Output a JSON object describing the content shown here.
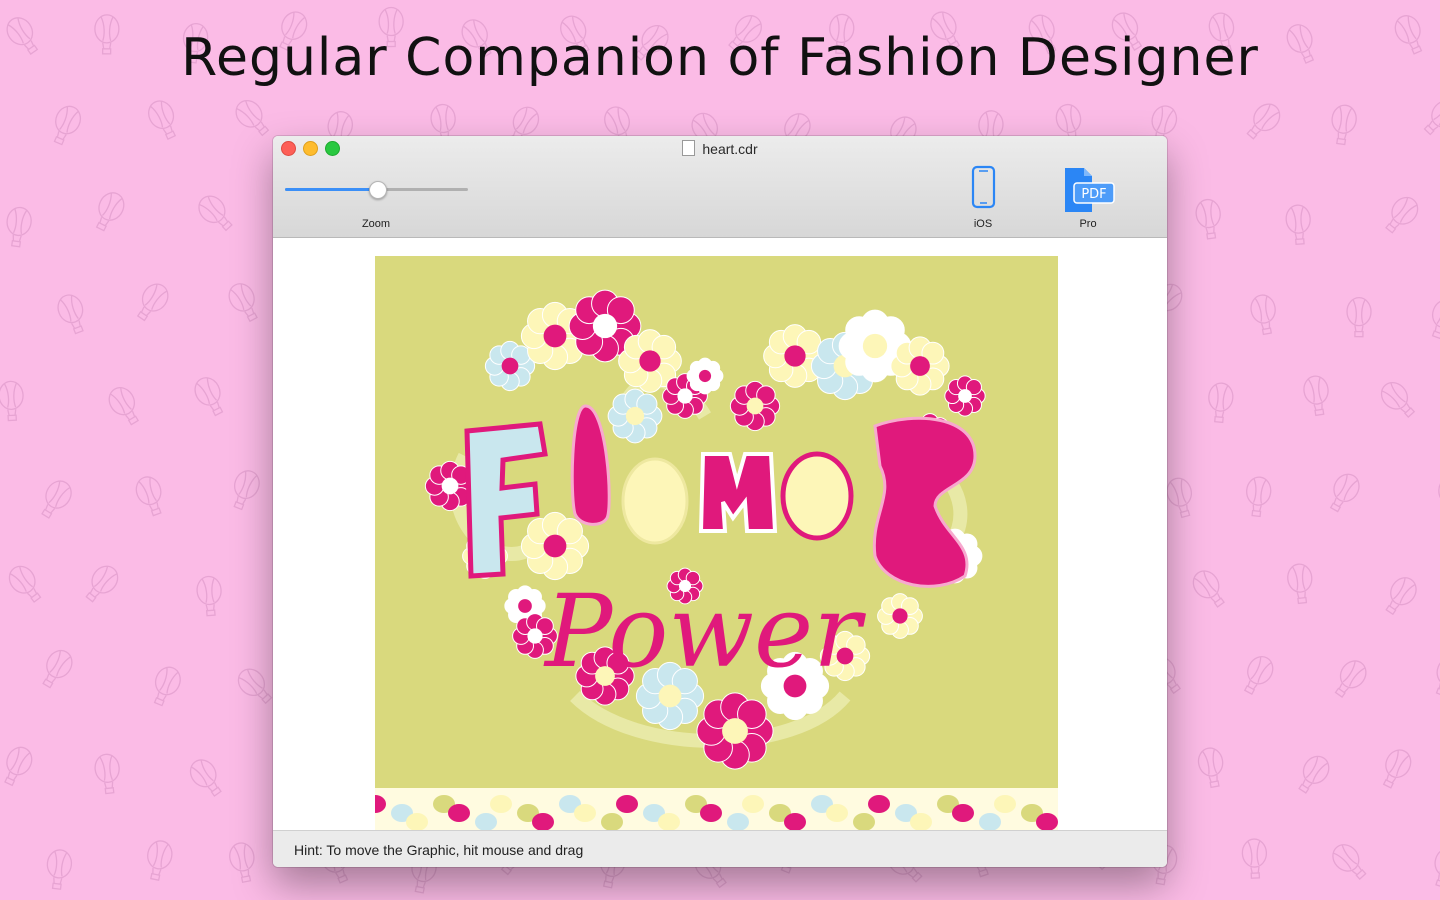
{
  "headline": "Regular Companion of Fashion Designer",
  "window": {
    "title": "heart.cdr",
    "zoom_label": "Zoom",
    "zoom_level": 0.5,
    "ios_label": "iOS",
    "pro_label": "Pro",
    "pro_badge": "PDF",
    "hint": "Hint: To move the Graphic, hit mouse and drag"
  },
  "artwork": {
    "title_word": "Flower",
    "subtitle_word": "Power",
    "colors": {
      "background": "#d9d97d",
      "magenta": "#e0197c",
      "cream": "#fdf6b8",
      "light_blue": "#c9e7ee",
      "white": "#ffffff"
    }
  },
  "colors": {
    "page_background": "#fbbbe6",
    "accent_blue": "#3b8ff7"
  }
}
